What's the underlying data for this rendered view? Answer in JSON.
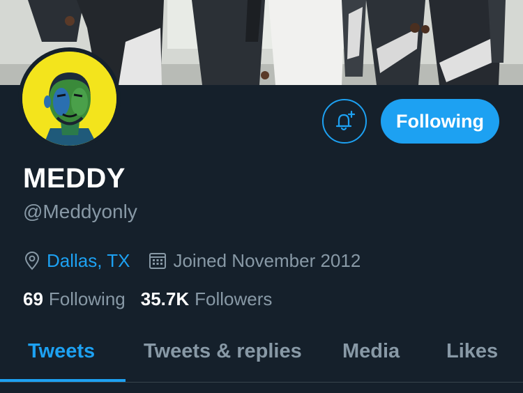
{
  "profile": {
    "name": "MEDDY",
    "handle": "@Meddyonly",
    "location": "Dallas, TX",
    "joined": "Joined November 2012",
    "following_count": "69",
    "following_label": "Following",
    "followers_count": "35.7K",
    "followers_label": "Followers"
  },
  "actions": {
    "notify_icon": "bell-plus-icon",
    "follow_label": "Following"
  },
  "tabs": [
    {
      "label": "Tweets",
      "active": true
    },
    {
      "label": "Tweets & replies",
      "active": false
    },
    {
      "label": "Media",
      "active": false
    },
    {
      "label": "Likes",
      "active": false
    }
  ],
  "colors": {
    "background": "#15202b",
    "accent": "#1da1f2",
    "muted": "#8899a6",
    "avatar_bg": "#f3e41c"
  }
}
